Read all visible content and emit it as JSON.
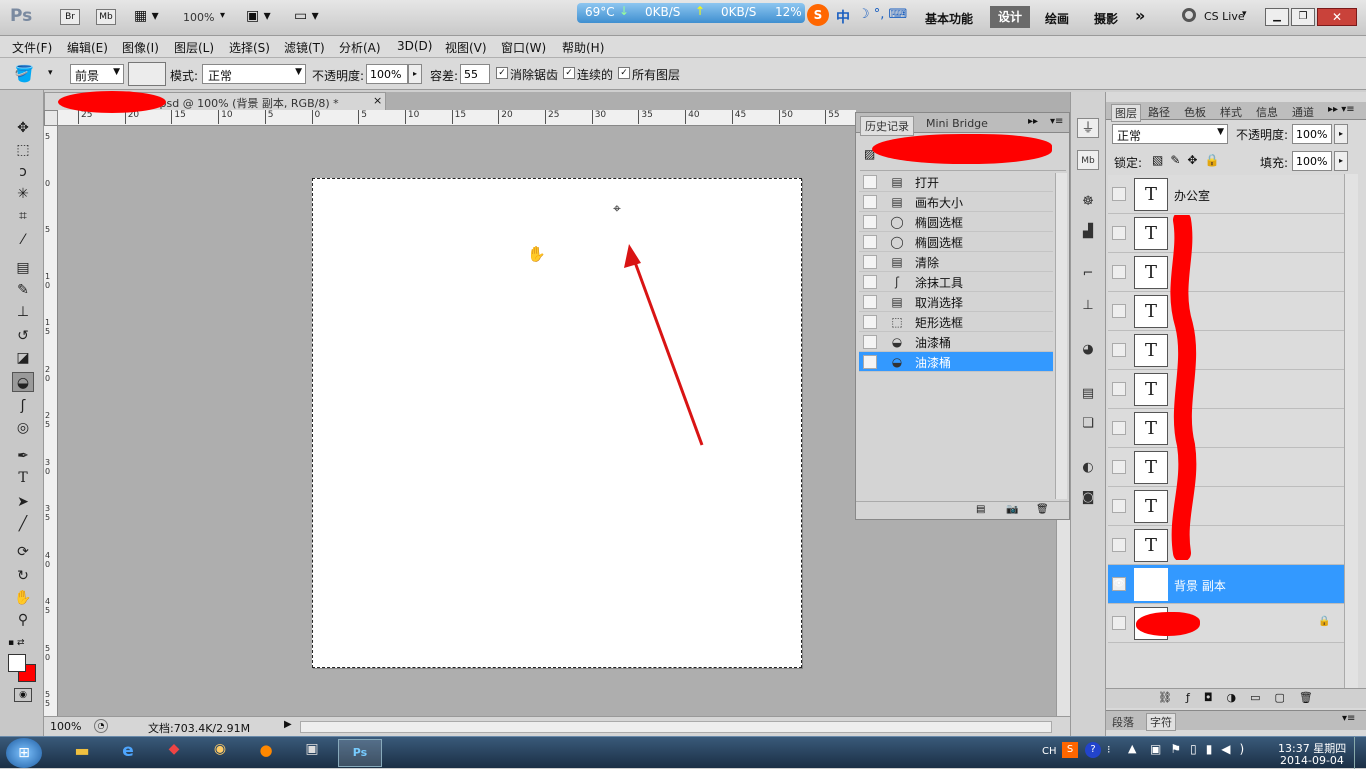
{
  "appbar": {
    "ps_logo": "Ps",
    "br": "Br",
    "mb": "Mb",
    "zoom": "100%",
    "net_temp": "69°C",
    "net_down": "0KB/S",
    "net_up": "0KB/S",
    "net_pct": "12%",
    "ime_cn": "中",
    "workspace_essentials": "基本功能",
    "workspace_design": "设计",
    "workspace_paint": "绘画",
    "workspace_photo": "摄影",
    "more": "»",
    "cslive": "CS Live"
  },
  "menu": [
    "文件(F)",
    "编辑(E)",
    "图像(I)",
    "图层(L)",
    "选择(S)",
    "滤镜(T)",
    "分析(A)",
    "3D(D)",
    "视图(V)",
    "窗口(W)",
    "帮助(H)"
  ],
  "options": {
    "fill_label": "前景",
    "mode_label": "模式:",
    "mode_value": "正常",
    "opacity_label": "不透明度:",
    "opacity_value": "100%",
    "tolerance_label": "容差:",
    "tolerance_value": "55",
    "antialias": "消除锯齿",
    "contiguous": "连续的",
    "all_layers": "所有图层"
  },
  "doc": {
    "tab_title": "办.psd @ 100% (背景 副本, RGB/8) *",
    "tab_close": "×",
    "ruler_h": [
      "25",
      "20",
      "15",
      "10",
      "5",
      "0",
      "5",
      "10",
      "15",
      "20",
      "25",
      "30",
      "35",
      "40",
      "45",
      "50",
      "55"
    ],
    "ruler_v": [
      "5",
      "0",
      "5",
      "1 0",
      "1 5",
      "2 0",
      "2 5",
      "3 0",
      "3 5",
      "4 0",
      "4 5",
      "5 0",
      "5 5"
    ],
    "status_zoom": "100%",
    "status_doc": "文档:703.4K/2.91M"
  },
  "history": {
    "tab_history": "历史记录",
    "tab_minibridge": "Mini Bridge",
    "items": [
      {
        "label": "打开",
        "icon": "document-icon"
      },
      {
        "label": "画布大小",
        "icon": "document-icon"
      },
      {
        "label": "椭圆选框",
        "icon": "ellipse-select-icon"
      },
      {
        "label": "椭圆选框",
        "icon": "ellipse-select-icon"
      },
      {
        "label": "清除",
        "icon": "document-icon"
      },
      {
        "label": "涂抹工具",
        "icon": "smudge-icon"
      },
      {
        "label": "取消选择",
        "icon": "document-icon"
      },
      {
        "label": "矩形选框",
        "icon": "rect-select-icon"
      },
      {
        "label": "油漆桶",
        "icon": "paint-bucket-icon"
      },
      {
        "label": "油漆桶",
        "icon": "paint-bucket-icon"
      }
    ]
  },
  "layers_panel": {
    "tabs": [
      "图层",
      "路径",
      "色板",
      "样式",
      "信息",
      "通道"
    ],
    "blend_mode": "正常",
    "opacity_label": "不透明度:",
    "opacity_value": "100%",
    "lock_label": "锁定:",
    "fill_label": "填充:",
    "fill_value": "100%",
    "layers": [
      {
        "name": "办公室",
        "thumb": "T"
      },
      {
        "name": "",
        "thumb": "T"
      },
      {
        "name": "",
        "thumb": "T"
      },
      {
        "name": "",
        "thumb": "T"
      },
      {
        "name": "",
        "thumb": "T"
      },
      {
        "name": "",
        "thumb": "T"
      },
      {
        "name": "",
        "thumb": "T"
      },
      {
        "name": "",
        "thumb": "T"
      },
      {
        "name": "",
        "thumb": "T"
      },
      {
        "name": "",
        "thumb": "T"
      },
      {
        "name": "背景 副本",
        "thumb": ""
      },
      {
        "name": "",
        "thumb": ""
      }
    ],
    "bottom_tabs": [
      "段落",
      "字符"
    ]
  },
  "taskbar": {
    "lang": "CH",
    "time": "13:37 星期四",
    "date": "2014-09-04"
  },
  "colors": {
    "selected_row": "#3399ff",
    "annotation_red": "#ff0000"
  }
}
